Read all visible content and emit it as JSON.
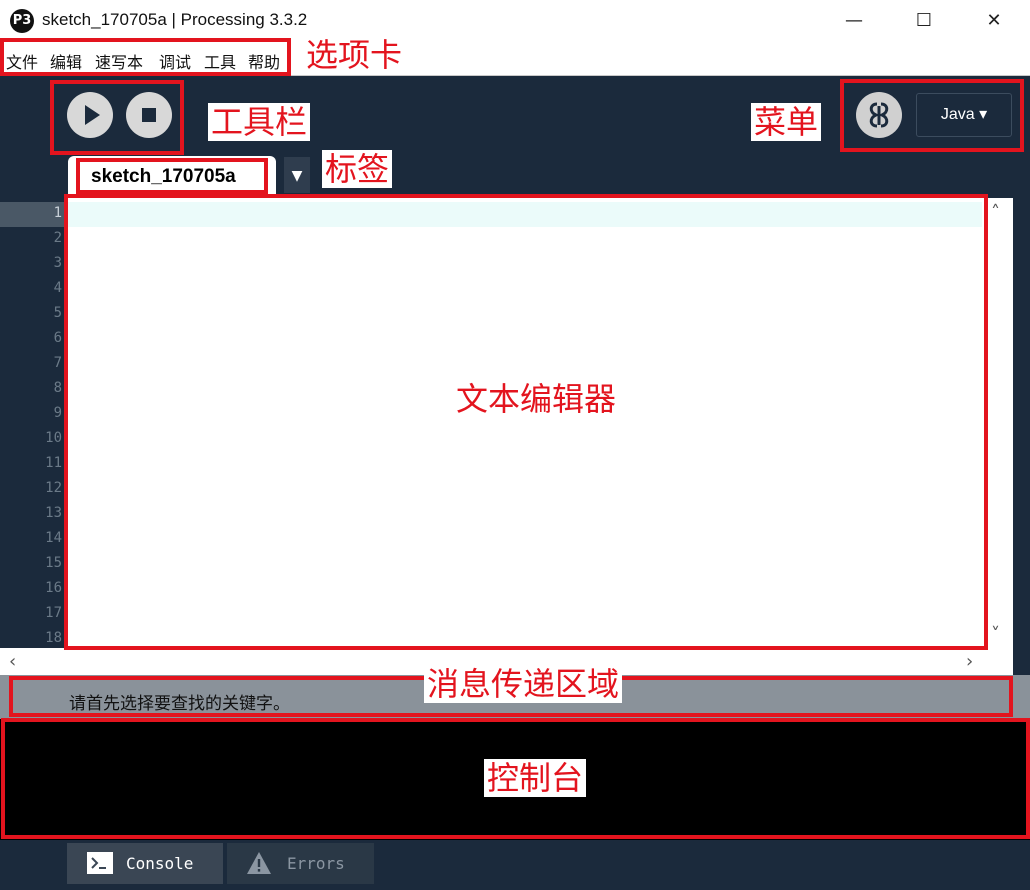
{
  "window": {
    "title": "sketch_170705a | Processing 3.3.2",
    "logo": "P3",
    "minimize": "—",
    "maximize": "☐",
    "close": "✕"
  },
  "menu": {
    "items": [
      "文件",
      "编辑",
      "速写本",
      "调试",
      "工具",
      "帮助"
    ]
  },
  "toolbar": {
    "mode_label": "Java ▾"
  },
  "tab": {
    "label": "sketch_170705a",
    "menu_arrow": "▼"
  },
  "editor": {
    "line_numbers": [
      "1",
      "2",
      "3",
      "4",
      "5",
      "6",
      "7",
      "8",
      "9",
      "10",
      "11",
      "12",
      "13",
      "14",
      "15",
      "16",
      "17",
      "18"
    ],
    "current_line": 1
  },
  "scroll": {
    "up": "˄",
    "down": "˅",
    "left": "‹",
    "right": "›"
  },
  "message": {
    "text": "请首先选择要查找的关键字。"
  },
  "bottom_tabs": [
    {
      "label": "Console",
      "icon": "terminal-icon"
    },
    {
      "label": "Errors",
      "icon": "warning-icon"
    }
  ],
  "annotations": {
    "menu": "选项卡",
    "toolbar": "工具栏",
    "modes": "菜单",
    "tab": "标签",
    "editor": "文本编辑器",
    "message": "消息传递区域",
    "console": "控制台"
  },
  "colors": {
    "annotation_red": "#e3141e",
    "ide_dark": "#1b2a3c",
    "message_gray": "#8a929a",
    "console_black": "#000000"
  }
}
